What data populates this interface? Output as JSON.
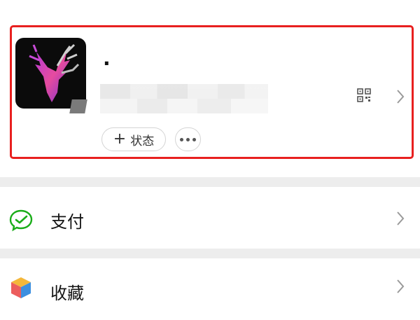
{
  "profile": {
    "nickname": ".",
    "status_button_label": "状态",
    "status_button_plus": "+"
  },
  "menu": {
    "items": [
      {
        "label": "支付",
        "icon": "wechat-pay-icon"
      },
      {
        "label": "收藏",
        "icon": "favorites-cube-icon"
      }
    ]
  },
  "colors": {
    "highlight_border": "#e8201f",
    "pay_green": "#1aad19",
    "divider_gray": "#ededed"
  }
}
